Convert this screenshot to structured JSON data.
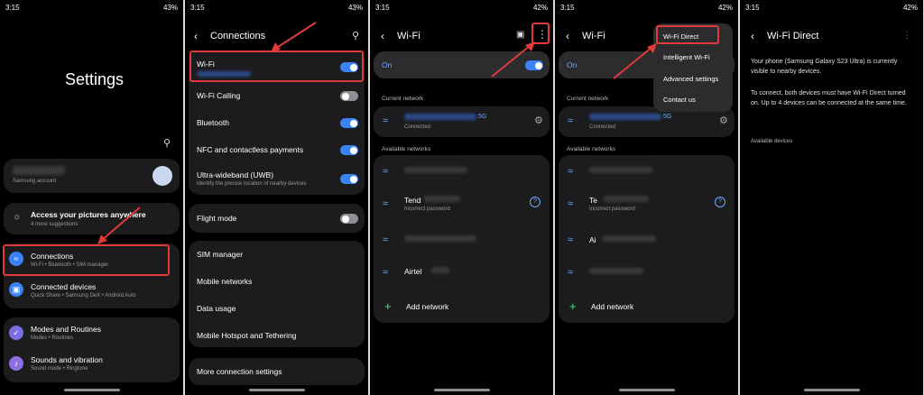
{
  "screen1": {
    "status_time": "3:15",
    "battery": "43%",
    "title": "Settings",
    "account_label": "Samsung account",
    "access_title": "Access your pictures anywhere",
    "access_sub": "4 more suggestions",
    "items": [
      {
        "label": "Connections",
        "sub": "Wi-Fi • Bluetooth • SIM manager",
        "icon": "wifi-icon",
        "color": "#3b82f6"
      },
      {
        "label": "Connected devices",
        "sub": "Quick Share • Samsung DeX • Android Auto",
        "icon": "devices-icon",
        "color": "#3b82f6"
      },
      {
        "label": "Modes and Routines",
        "sub": "Modes • Routines",
        "icon": "check-circle-icon",
        "color": "#7c6fe3"
      },
      {
        "label": "Sounds and vibration",
        "sub": "Sound mode • Ringtone",
        "icon": "speaker-icon",
        "color": "#8e6fe3"
      }
    ]
  },
  "screen2": {
    "status_time": "3:15",
    "battery": "43%",
    "title": "Connections",
    "items": [
      {
        "label": "Wi-Fi",
        "toggle": true
      },
      {
        "label": "Wi-Fi Calling",
        "toggle": false
      },
      {
        "label": "Bluetooth",
        "toggle": true
      },
      {
        "label": "NFC and contactless payments",
        "toggle": true
      },
      {
        "label": "Ultra-wideband (UWB)",
        "sub": "Identify the precise location of nearby devices",
        "toggle": true
      },
      {
        "label": "Flight mode",
        "toggle": false
      },
      {
        "label": "SIM manager"
      },
      {
        "label": "Mobile networks"
      },
      {
        "label": "Data usage"
      },
      {
        "label": "Mobile Hotspot and Tethering"
      },
      {
        "label": "More connection settings"
      }
    ]
  },
  "screen3": {
    "status_time": "3:15",
    "battery": "42%",
    "title": "Wi-Fi",
    "on_label": "On",
    "current_network": "Current network",
    "current_suffix": "5G",
    "connected": "Connected",
    "available_networks": "Available networks",
    "net2_prefix": "Tend",
    "net2_sub": "Incorrect password",
    "net4": "Airtel",
    "add_network": "Add network"
  },
  "screen4": {
    "status_time": "3:15",
    "battery": "42%",
    "title": "Wi-Fi",
    "on_label": "On",
    "current_network": "Current network",
    "current_suffix": "5G",
    "connected": "Connected",
    "available_networks": "Available networks",
    "net2_prefix": "Te",
    "net2_sub": "Incorrect password",
    "net3_prefix": "Ai",
    "add_network": "Add network",
    "menu": [
      "Wi-Fi Direct",
      "Intelligent Wi-Fi",
      "Advanced settings",
      "Contact us"
    ]
  },
  "screen5": {
    "status_time": "3:15",
    "battery": "42%",
    "title": "Wi-Fi Direct",
    "para1": "Your phone (Samsung Galaxy S23 Ultra) is currently visible to nearby devices.",
    "para2": "To connect, both devices must have Wi-Fi Direct turned on. Up to 4 devices can be connected at the same time.",
    "available_devices": "Available devices"
  },
  "colors": {
    "accent": "#3b82f6",
    "highlight": "#e03a3a",
    "card": "#1c1c1e"
  }
}
